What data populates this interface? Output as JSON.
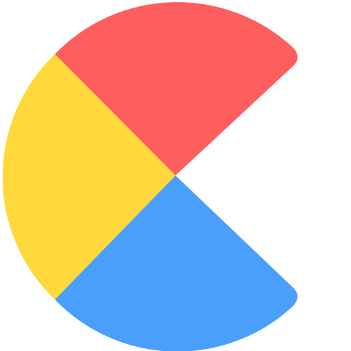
{
  "logo": {
    "segments": [
      {
        "name": "red",
        "color": "#ff5e5e"
      },
      {
        "name": "yellow",
        "color": "#ffd93b"
      },
      {
        "name": "blue",
        "color": "#4a9ffc"
      }
    ],
    "background_color": "#ffffff"
  }
}
